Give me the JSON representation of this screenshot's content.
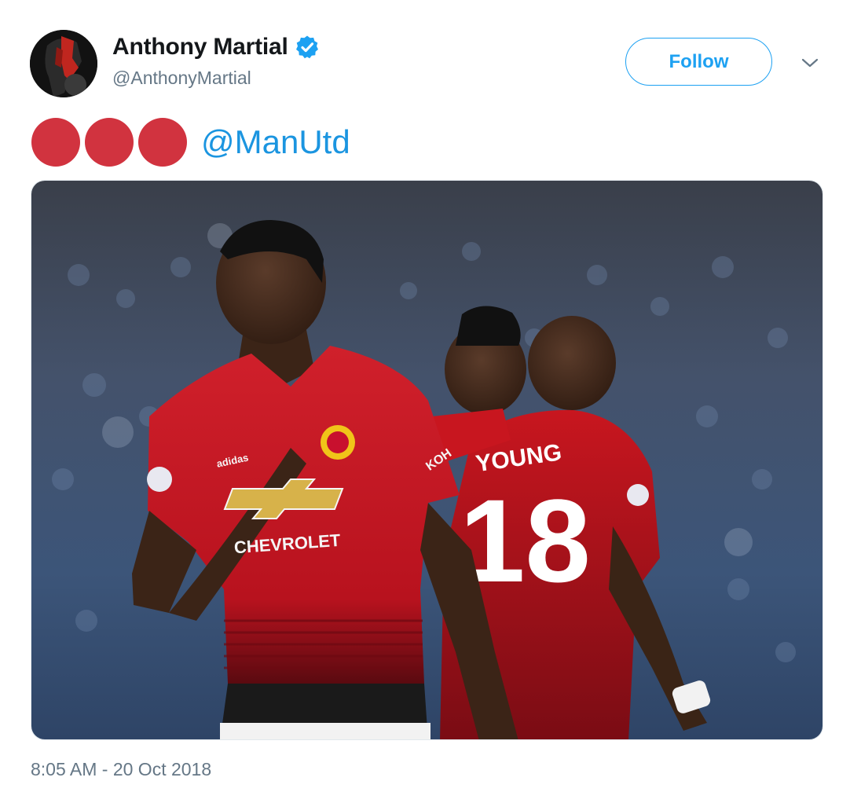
{
  "tweet": {
    "author": {
      "display_name": "Anthony Martial",
      "handle": "@AnthonyMartial",
      "verified": true
    },
    "follow_button_label": "Follow",
    "menu_icon": "chevron-down-icon",
    "text": {
      "emoji": [
        "red-circle",
        "red-circle",
        "red-circle"
      ],
      "mention": "@ManUtd"
    },
    "photo": {
      "shirt_sponsor": "CHEVROLET",
      "kit_brand": "adidas",
      "sleeve_text": "KOH",
      "teammate_name": "YOUNG",
      "teammate_number": "18"
    },
    "timestamp": "8:05 AM - 20 Oct 2018"
  },
  "colors": {
    "twitter_blue": "#1da1f2",
    "mention_blue": "#1b95e0",
    "emoji_red": "#d1333f",
    "kit_red": "#c8102e",
    "secondary_text": "#657786"
  }
}
